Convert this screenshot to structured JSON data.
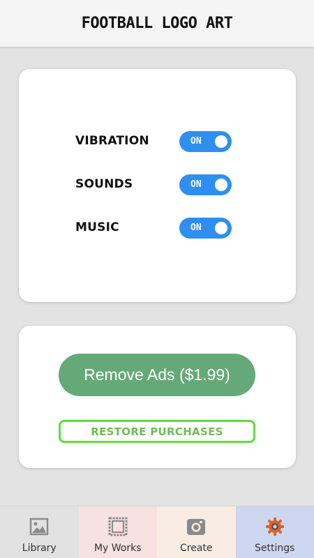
{
  "header": {
    "title": "FOOTBALL LOGO ART"
  },
  "settings": {
    "items": [
      {
        "label": "VIBRATION",
        "state": "ON"
      },
      {
        "label": "SOUNDS",
        "state": "ON"
      },
      {
        "label": "MUSIC",
        "state": "ON"
      }
    ]
  },
  "purchase": {
    "remove_ads_label": "Remove Ads ($1.99)",
    "restore_label": "RESTORE PURCHASES"
  },
  "tabs": [
    {
      "label": "Library",
      "icon": "image-icon",
      "bg": "#e2e2e2"
    },
    {
      "label": "My Works",
      "icon": "frame-icon",
      "bg": "#f8e1e1"
    },
    {
      "label": "Create",
      "icon": "camera-icon",
      "bg": "#f8ece3"
    },
    {
      "label": "Settings",
      "icon": "gear-icon",
      "bg": "#cdd7ef"
    }
  ],
  "colors": {
    "toggle_on": "#2e8ff0",
    "remove_ads_button": "#66a978",
    "restore_border": "#5ce03a",
    "gear_icon": "#e0612b"
  }
}
